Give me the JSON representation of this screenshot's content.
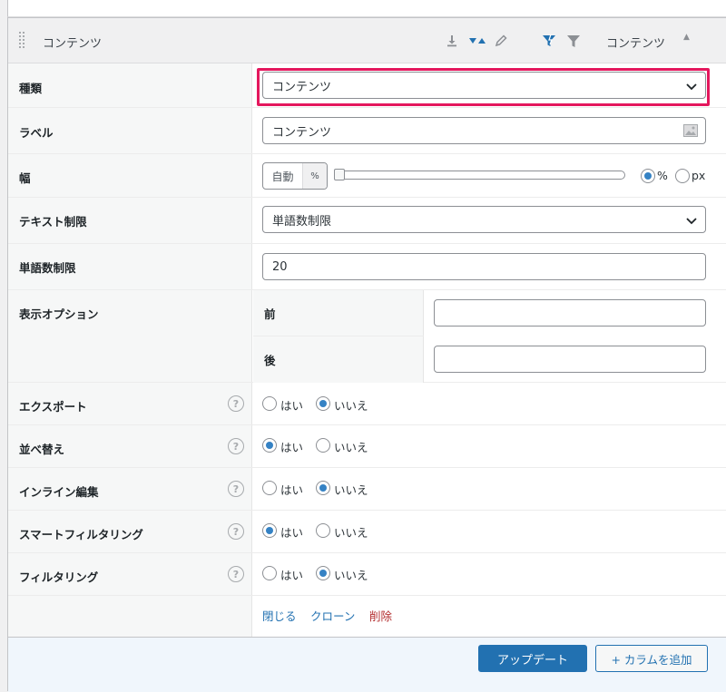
{
  "header": {
    "title": "コンテンツ",
    "column_name": "コンテンツ",
    "icons": [
      "download-icon",
      "sort-icon",
      "edit-icon",
      "smart-filter-icon",
      "filter-icon",
      "collapse-arrow-icon"
    ]
  },
  "fields": {
    "type": {
      "label": "種類",
      "value": "コンテンツ"
    },
    "label": {
      "label": "ラベル",
      "value": "コンテンツ"
    },
    "width": {
      "label": "幅",
      "value": "自動",
      "unit": "%",
      "slider_value": 0,
      "options": [
        "%",
        "px"
      ],
      "selected": "%"
    },
    "text_limit": {
      "label": "テキスト制限",
      "value": "単語数制限"
    },
    "word_limit": {
      "label": "単語数制限",
      "value": "20"
    },
    "display_options": {
      "label": "表示オプション",
      "before_label": "前",
      "before_value": "",
      "after_label": "後",
      "after_value": ""
    },
    "export": {
      "label": "エクスポート",
      "yes": "はい",
      "no": "いいえ",
      "selected": "no"
    },
    "sort": {
      "label": "並べ替え",
      "yes": "はい",
      "no": "いいえ",
      "selected": "yes"
    },
    "inline_edit": {
      "label": "インライン編集",
      "yes": "はい",
      "no": "いいえ",
      "selected": "no"
    },
    "smart_filter": {
      "label": "スマートフィルタリング",
      "yes": "はい",
      "no": "いいえ",
      "selected": "yes"
    },
    "filter": {
      "label": "フィルタリング",
      "yes": "はい",
      "no": "いいえ",
      "selected": "no"
    }
  },
  "actions": {
    "close": "閉じる",
    "clone": "クローン",
    "delete": "削除"
  },
  "footer": {
    "update": "アップデート",
    "add_column": "+ カラムを追加"
  },
  "colors": {
    "accent": "#2271b1",
    "highlight": "#e4175d",
    "danger": "#b32d2e",
    "radio": "#3582c4"
  }
}
